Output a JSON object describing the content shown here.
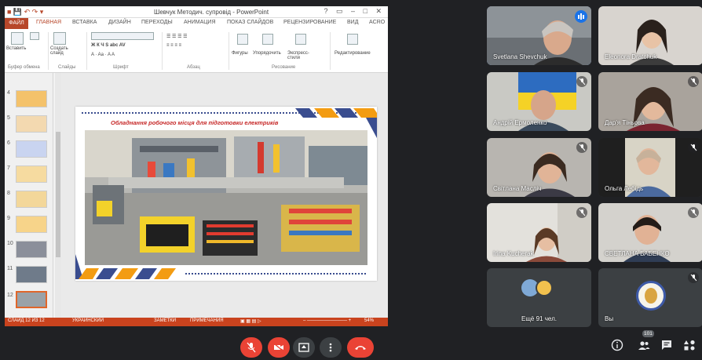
{
  "powerpoint": {
    "title": "Шевчук Методич. супровід - PowerPoint",
    "window_controls": "? ▭ – □ ✕",
    "tabs": [
      "ФАЙЛ",
      "ГЛАВНАЯ",
      "ВСТАВКА",
      "ДИЗАЙН",
      "ПЕРЕХОДЫ",
      "АНИМАЦИЯ",
      "ПОКАЗ СЛАЙДОВ",
      "РЕЦЕНЗИРОВАНИЕ",
      "ВИД",
      "ACRO"
    ],
    "active_tab": "ГЛАВНАЯ",
    "ribbon": {
      "paste": "Вставить",
      "new_slide": "Создать слайд",
      "shapes": "Фигуры",
      "arrange": "Упорядочить",
      "quick_styles": "Экспресс-стили",
      "editing": "Редактирование",
      "groups": [
        "Буфер обмена",
        "Слайды",
        "Шрифт",
        "Абзац",
        "Рисование"
      ]
    },
    "thumbnail_numbers": [
      "4",
      "5",
      "6",
      "7",
      "8",
      "9",
      "10",
      "11",
      "12"
    ],
    "selected_slide": "12",
    "slide": {
      "heading": "Обладнання робочого місця для підготовки електриків"
    },
    "status": {
      "slide_info": "СЛАЙД 12 ИЗ 12",
      "language": "УКРАИНСКИЙ",
      "notes": "ЗАМЕТКИ",
      "comments": "ПРИМЕЧАНИЯ",
      "zoom": "54%"
    }
  },
  "participants": [
    {
      "name": "Svetlana Shevchuk",
      "speaking": true
    },
    {
      "name": "Eleonora Dratchuk",
      "muted": false
    },
    {
      "name": "Андрій Ермоленко",
      "muted": true
    },
    {
      "name": "Дар'я Тіньова",
      "muted": true
    },
    {
      "name": "Світлана Масліч",
      "muted": true
    },
    {
      "name": "Ольга Лебідь",
      "muted": true
    },
    {
      "name": "Irina Kucherak",
      "muted": true
    },
    {
      "name": "СВЕТЛАНА БАБЕНКО",
      "muted": true
    },
    {
      "name": "Ещё 91 чел."
    },
    {
      "name": "Вы",
      "muted": true
    }
  ],
  "toolbar": {
    "people_count": "101"
  },
  "colors": {
    "background": "#202124",
    "tile": "#3c4043",
    "red": "#ea4335",
    "ppt_accent": "#b7472a",
    "speaker_blue": "#1a73e8"
  },
  "icons": [
    "mic-off-icon",
    "camera-off-icon",
    "present-icon",
    "more-icon",
    "hangup-icon",
    "info-icon",
    "people-icon",
    "chat-icon",
    "activities-icon"
  ]
}
